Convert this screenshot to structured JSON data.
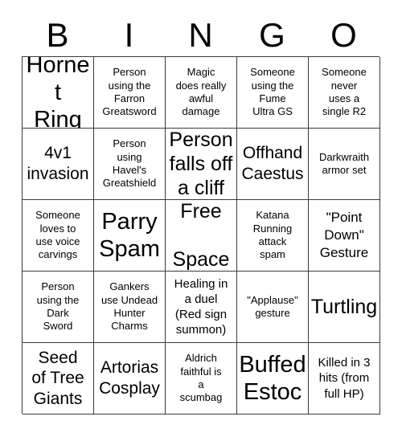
{
  "card": {
    "title": "BINGO",
    "header_letters": [
      "B",
      "I",
      "N",
      "G",
      "O"
    ],
    "columns": 5,
    "rows": 5,
    "border_color": "#3a3a3a",
    "background_color": "#ffffff",
    "text_color": "#000000",
    "cells": [
      {
        "text": "Hornet\nRing",
        "size": "huge",
        "marked": false
      },
      {
        "text": "Person\nusing the\nFarron\nGreatsword",
        "size": "sm",
        "marked": false
      },
      {
        "text": "Magic\ndoes really\nawful\ndamage",
        "size": "sm",
        "marked": false
      },
      {
        "text": "Someone\nusing the\nFume\nUltra GS",
        "size": "sm",
        "marked": false
      },
      {
        "text": "Someone\nnever\nuses a\nsingle R2",
        "size": "sm",
        "marked": false
      },
      {
        "text": "4v1\ninvasion",
        "size": "xl",
        "marked": false
      },
      {
        "text": "Person\nusing\nHavel's\nGreatshield",
        "size": "sm",
        "marked": false
      },
      {
        "text": "Person\nfalls off\na cliff",
        "size": "xxl",
        "marked": false
      },
      {
        "text": "Offhand\nCaestus",
        "size": "xl",
        "marked": false
      },
      {
        "text": "Darkwraith\narmor set",
        "size": "sm",
        "marked": false
      },
      {
        "text": "Someone\nloves to\nuse voice\ncarvings",
        "size": "sm",
        "marked": false
      },
      {
        "text": "Parry\nSpam",
        "size": "huge",
        "marked": false
      },
      {
        "text": "Free\n\nSpace",
        "size": "xxl",
        "marked": false
      },
      {
        "text": "Katana\nRunning\nattack\nspam",
        "size": "sm",
        "marked": false
      },
      {
        "text": "\"Point\nDown\"\nGesture",
        "size": "lg",
        "marked": false
      },
      {
        "text": "Person\nusing the\nDark\nSword",
        "size": "sm",
        "marked": false
      },
      {
        "text": "Gankers\nuse Undead\nHunter\nCharms",
        "size": "sm",
        "marked": false
      },
      {
        "text": "Healing in\na duel\n(Red sign\nsummon)",
        "size": "md",
        "marked": false
      },
      {
        "text": "\"Applause\"\ngesture",
        "size": "sm",
        "marked": false
      },
      {
        "text": "Turtling",
        "size": "xxl",
        "marked": false
      },
      {
        "text": "Seed\nof Tree\nGiants",
        "size": "xl",
        "marked": false
      },
      {
        "text": "Artorias\nCosplay",
        "size": "xl",
        "marked": false
      },
      {
        "text": "Aldrich\nfaithful is\na\nscumbag",
        "size": "sm",
        "marked": false
      },
      {
        "text": "Buffed\nEstoc",
        "size": "huge",
        "marked": false
      },
      {
        "text": "Killed in 3\nhits (from\nfull HP)",
        "size": "md",
        "marked": false
      }
    ]
  }
}
